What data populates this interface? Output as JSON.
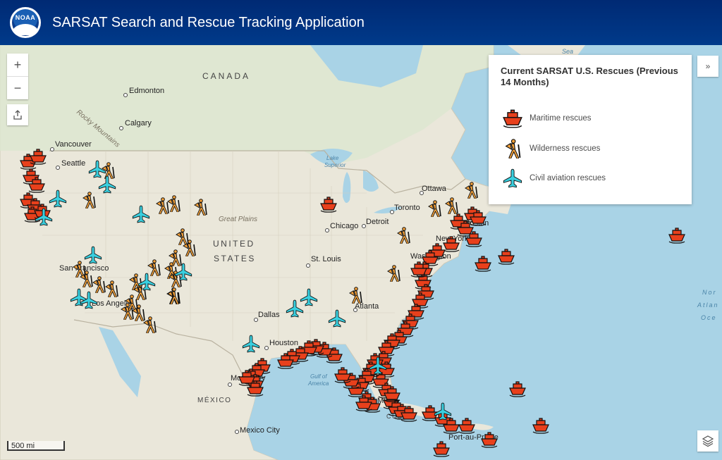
{
  "header": {
    "logo_text": "NOAA",
    "title": "SARSAT Search and Rescue Tracking Application"
  },
  "controls": {
    "zoom_in": "+",
    "zoom_out": "−",
    "collapse": "»",
    "scale": "500 mi"
  },
  "legend": {
    "title": "Current SARSAT U.S. Rescues (Previous 14 Months)",
    "items": [
      {
        "label": "Maritime rescues",
        "icon": "boat-icon"
      },
      {
        "label": "Wilderness rescues",
        "icon": "hiker-icon"
      },
      {
        "label": "Civil aviation rescues",
        "icon": "plane-icon"
      }
    ]
  },
  "colors": {
    "maritime": "#e8401c",
    "wilderness": "#f6a33b",
    "aviation": "#39d0e0",
    "water": "#a9d3e6",
    "land": "#eae7da",
    "header": "#002a74"
  },
  "map": {
    "countries": [
      "CANADA",
      "UNITED",
      "STATES",
      "MÉXICO",
      "CUBA"
    ],
    "cities": [
      "Edmonton",
      "Calgary",
      "Vancouver",
      "Seattle",
      "Ottawa",
      "Toronto",
      "Chicago",
      "Detroit",
      "St. Louis",
      "Dallas",
      "Atlanta",
      "Houston",
      "Monterrey",
      "Mexico City",
      "San Francisco",
      "Los Angeles",
      "New York",
      "Washington",
      "Boston",
      "Miami",
      "Port-au-Prince"
    ],
    "features": [
      "Rocky Mountains",
      "Great Plains",
      "Lake Superior",
      "Gulf of America",
      "North Atlantic Ocean",
      "Sea"
    ]
  }
}
